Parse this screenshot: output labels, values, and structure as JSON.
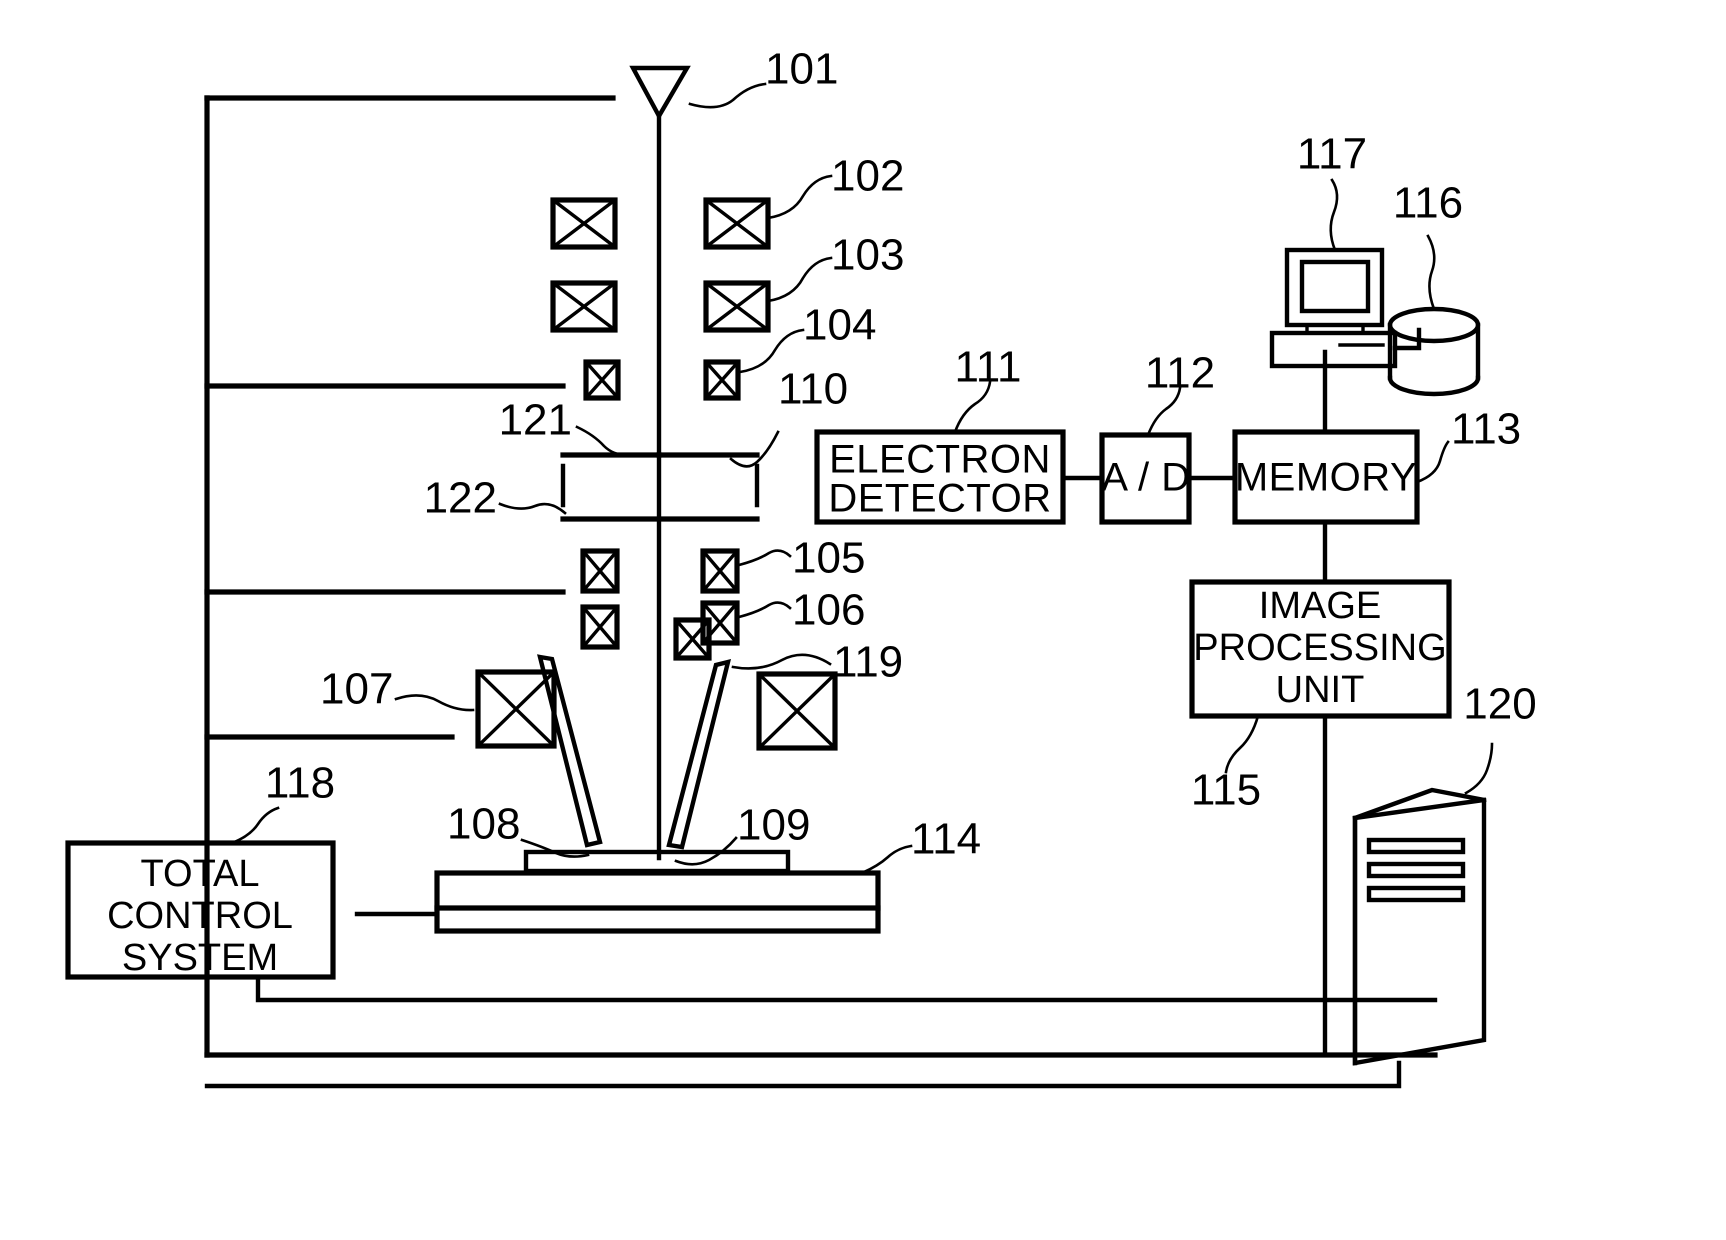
{
  "figure": {
    "title": "Scanning electron microscope system block diagram",
    "line_color": "#000000",
    "background": "#ffffff"
  },
  "blocks": [
    {
      "id": "111",
      "name": "electron-detector",
      "lines": [
        "ELECTRON",
        "DETECTOR"
      ]
    },
    {
      "id": "112",
      "name": "ad-converter",
      "lines": [
        "A / D"
      ]
    },
    {
      "id": "113",
      "name": "memory",
      "lines": [
        "MEMORY"
      ]
    },
    {
      "id": "115",
      "name": "image-processing-unit",
      "lines": [
        "IMAGE",
        "PROCESSING",
        "UNIT"
      ]
    },
    {
      "id": "118",
      "name": "total-control-system",
      "lines": [
        "TOTAL",
        "CONTROL",
        "SYSTEM"
      ]
    }
  ],
  "reference_numerals": [
    {
      "id": "101",
      "label": "101",
      "target": "electron-gun"
    },
    {
      "id": "102",
      "label": "102",
      "target": "condenser-lens-1"
    },
    {
      "id": "103",
      "label": "103",
      "target": "condenser-lens-2"
    },
    {
      "id": "104",
      "label": "104",
      "target": "aperture-coil"
    },
    {
      "id": "105",
      "label": "105",
      "target": "deflector-coil-upper"
    },
    {
      "id": "106",
      "label": "106",
      "target": "deflector-coil-lower"
    },
    {
      "id": "107",
      "label": "107",
      "target": "objective-lens"
    },
    {
      "id": "108",
      "label": "108",
      "target": "specimen"
    },
    {
      "id": "109",
      "label": "109",
      "target": "beam-landing-point"
    },
    {
      "id": "110",
      "label": "110",
      "target": "aperture-plate-right"
    },
    {
      "id": "111",
      "label": "111",
      "target": "electron-detector"
    },
    {
      "id": "112",
      "label": "112",
      "target": "ad-converter"
    },
    {
      "id": "113",
      "label": "113",
      "target": "memory"
    },
    {
      "id": "114",
      "label": "114",
      "target": "specimen-stage"
    },
    {
      "id": "115",
      "label": "115",
      "target": "image-processing-unit"
    },
    {
      "id": "116",
      "label": "116",
      "target": "disk-storage"
    },
    {
      "id": "117",
      "label": "117",
      "target": "display-terminal"
    },
    {
      "id": "118",
      "label": "118",
      "target": "total-control-system"
    },
    {
      "id": "119",
      "label": "119",
      "target": "detector-electrode"
    },
    {
      "id": "120",
      "label": "120",
      "target": "host-computer-tower"
    },
    {
      "id": "121",
      "label": "121",
      "target": "aperture-plate-upper"
    },
    {
      "id": "122",
      "label": "122",
      "target": "aperture-plate-lower"
    }
  ],
  "components": [
    {
      "name": "electron-gun",
      "shape": "triangle"
    },
    {
      "name": "electron-beam-axis",
      "shape": "vertical-line"
    },
    {
      "name": "lens-coil-pair",
      "shape": "crossed-box",
      "count": 12
    },
    {
      "name": "specimen-stage",
      "shape": "layered-slab"
    },
    {
      "name": "display-terminal",
      "shape": "crt-monitor"
    },
    {
      "name": "disk-storage",
      "shape": "cylinder"
    },
    {
      "name": "host-computer-tower",
      "shape": "3d-tower"
    },
    {
      "name": "control-bus",
      "shape": "orthogonal-wiring"
    }
  ]
}
